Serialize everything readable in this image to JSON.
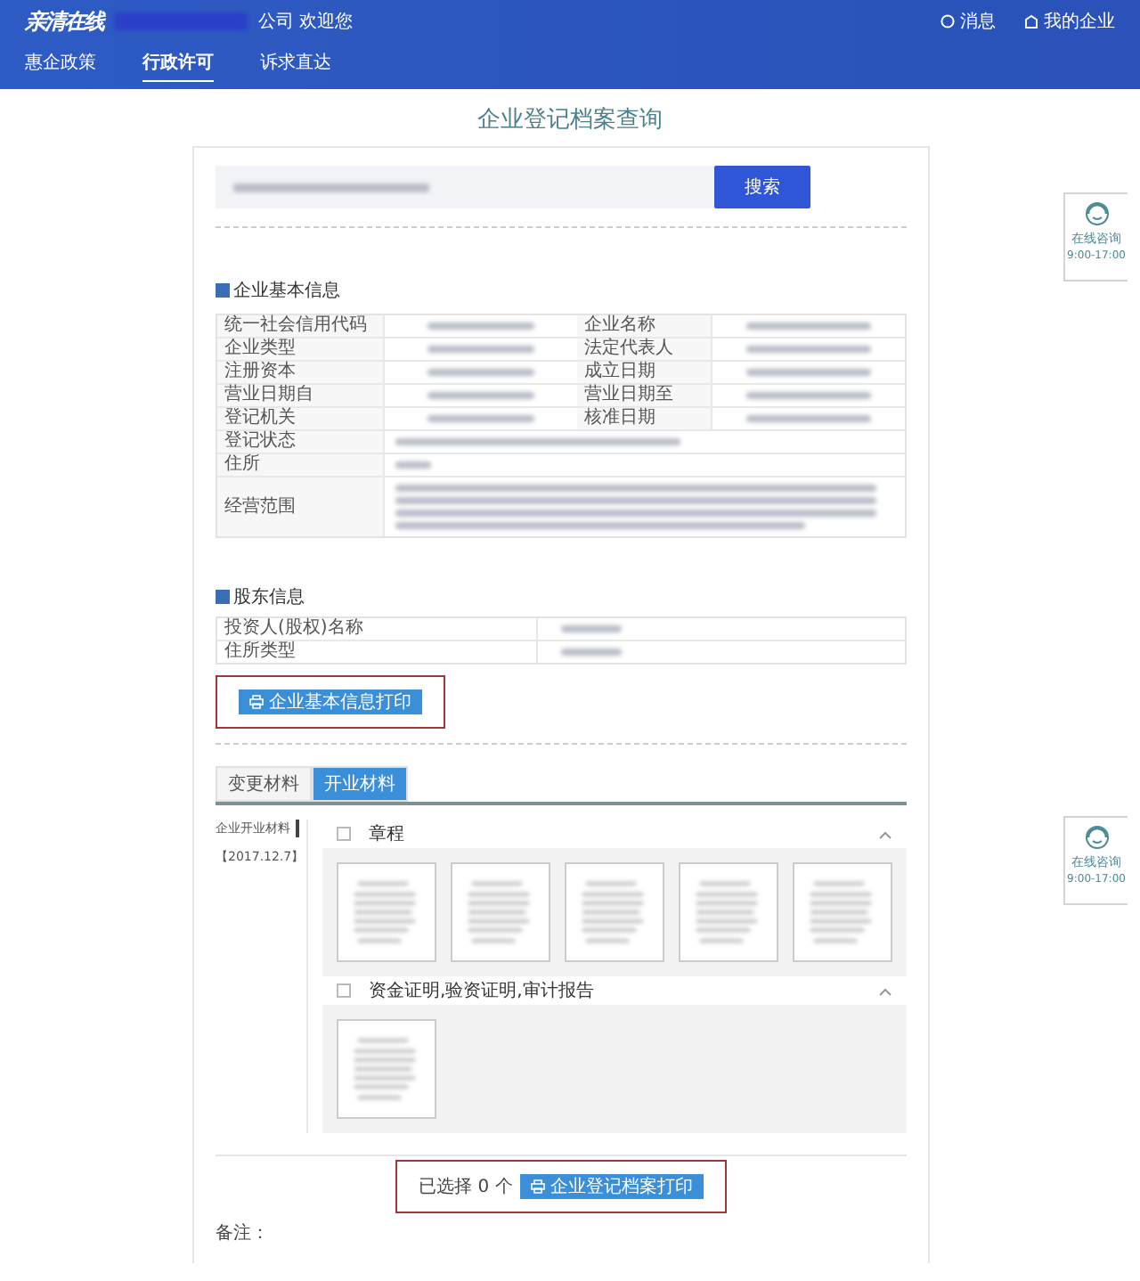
{
  "header": {
    "logo": "亲清在线",
    "greeting": "公司 欢迎您",
    "actions": [
      {
        "label": "消息",
        "kind": "message"
      },
      {
        "label": "我的企业",
        "kind": "company"
      }
    ]
  },
  "nav": [
    {
      "label": "惠企政策",
      "selected": false
    },
    {
      "label": "行政许可",
      "selected": true
    },
    {
      "label": "诉求直达",
      "selected": false
    }
  ],
  "title": "企业登记档案查询",
  "search": {
    "button": "搜索"
  },
  "basic_info": {
    "title": "企业基本信息",
    "checked": true,
    "rows": [
      {
        "kind": "pair",
        "cells": [
          "统一社会信用代码",
          "企业名称"
        ]
      },
      {
        "kind": "pair",
        "cells": [
          "企业类型",
          "法定代表人"
        ]
      },
      {
        "kind": "pair",
        "cells": [
          "注册资本",
          "成立日期"
        ]
      },
      {
        "kind": "pair",
        "cells": [
          "营业日期自",
          "营业日期至"
        ]
      },
      {
        "kind": "pair",
        "cells": [
          "登记机关",
          "核准日期"
        ]
      },
      {
        "kind": "single",
        "cells": [
          "登记状态"
        ]
      },
      {
        "kind": "single",
        "cells": [
          "住所"
        ]
      },
      {
        "kind": "multiline",
        "cells": [
          "经营范围"
        ]
      }
    ]
  },
  "shareholders": {
    "title": "股东信息",
    "checked": true,
    "rows": [
      "投资人(股权)名称",
      "住所类型"
    ]
  },
  "basic_print": {
    "label": "企业基本信息打印",
    "highlighted": true
  },
  "materials": {
    "tabs": [
      {
        "label": "变更材料",
        "selected": false
      },
      {
        "label": "开业材料",
        "selected": true
      }
    ],
    "side": [
      {
        "label": "企业开业材料",
        "selected": true
      },
      {
        "label": "【2017.12.7】",
        "selected": false
      }
    ],
    "groups": [
      {
        "title": "章程",
        "checked": false,
        "expanded": true,
        "documents": [
          {
            "kind": "document"
          },
          {
            "kind": "document"
          },
          {
            "kind": "document"
          },
          {
            "kind": "document"
          },
          {
            "kind": "document"
          }
        ]
      },
      {
        "title": "资金证明,验资证明,审计报告",
        "checked": false,
        "expanded": true,
        "documents": [
          {
            "kind": "document"
          }
        ]
      }
    ]
  },
  "footer": {
    "selected_text": "已选择 0 个",
    "print": {
      "label": "企业登记档案打印",
      "highlighted": true
    },
    "note": "备注："
  },
  "consult": [
    {
      "label": "在线咨询",
      "hours": "9:00-17:00"
    },
    {
      "label": "在线咨询",
      "hours": "9:00-17:00"
    }
  ]
}
